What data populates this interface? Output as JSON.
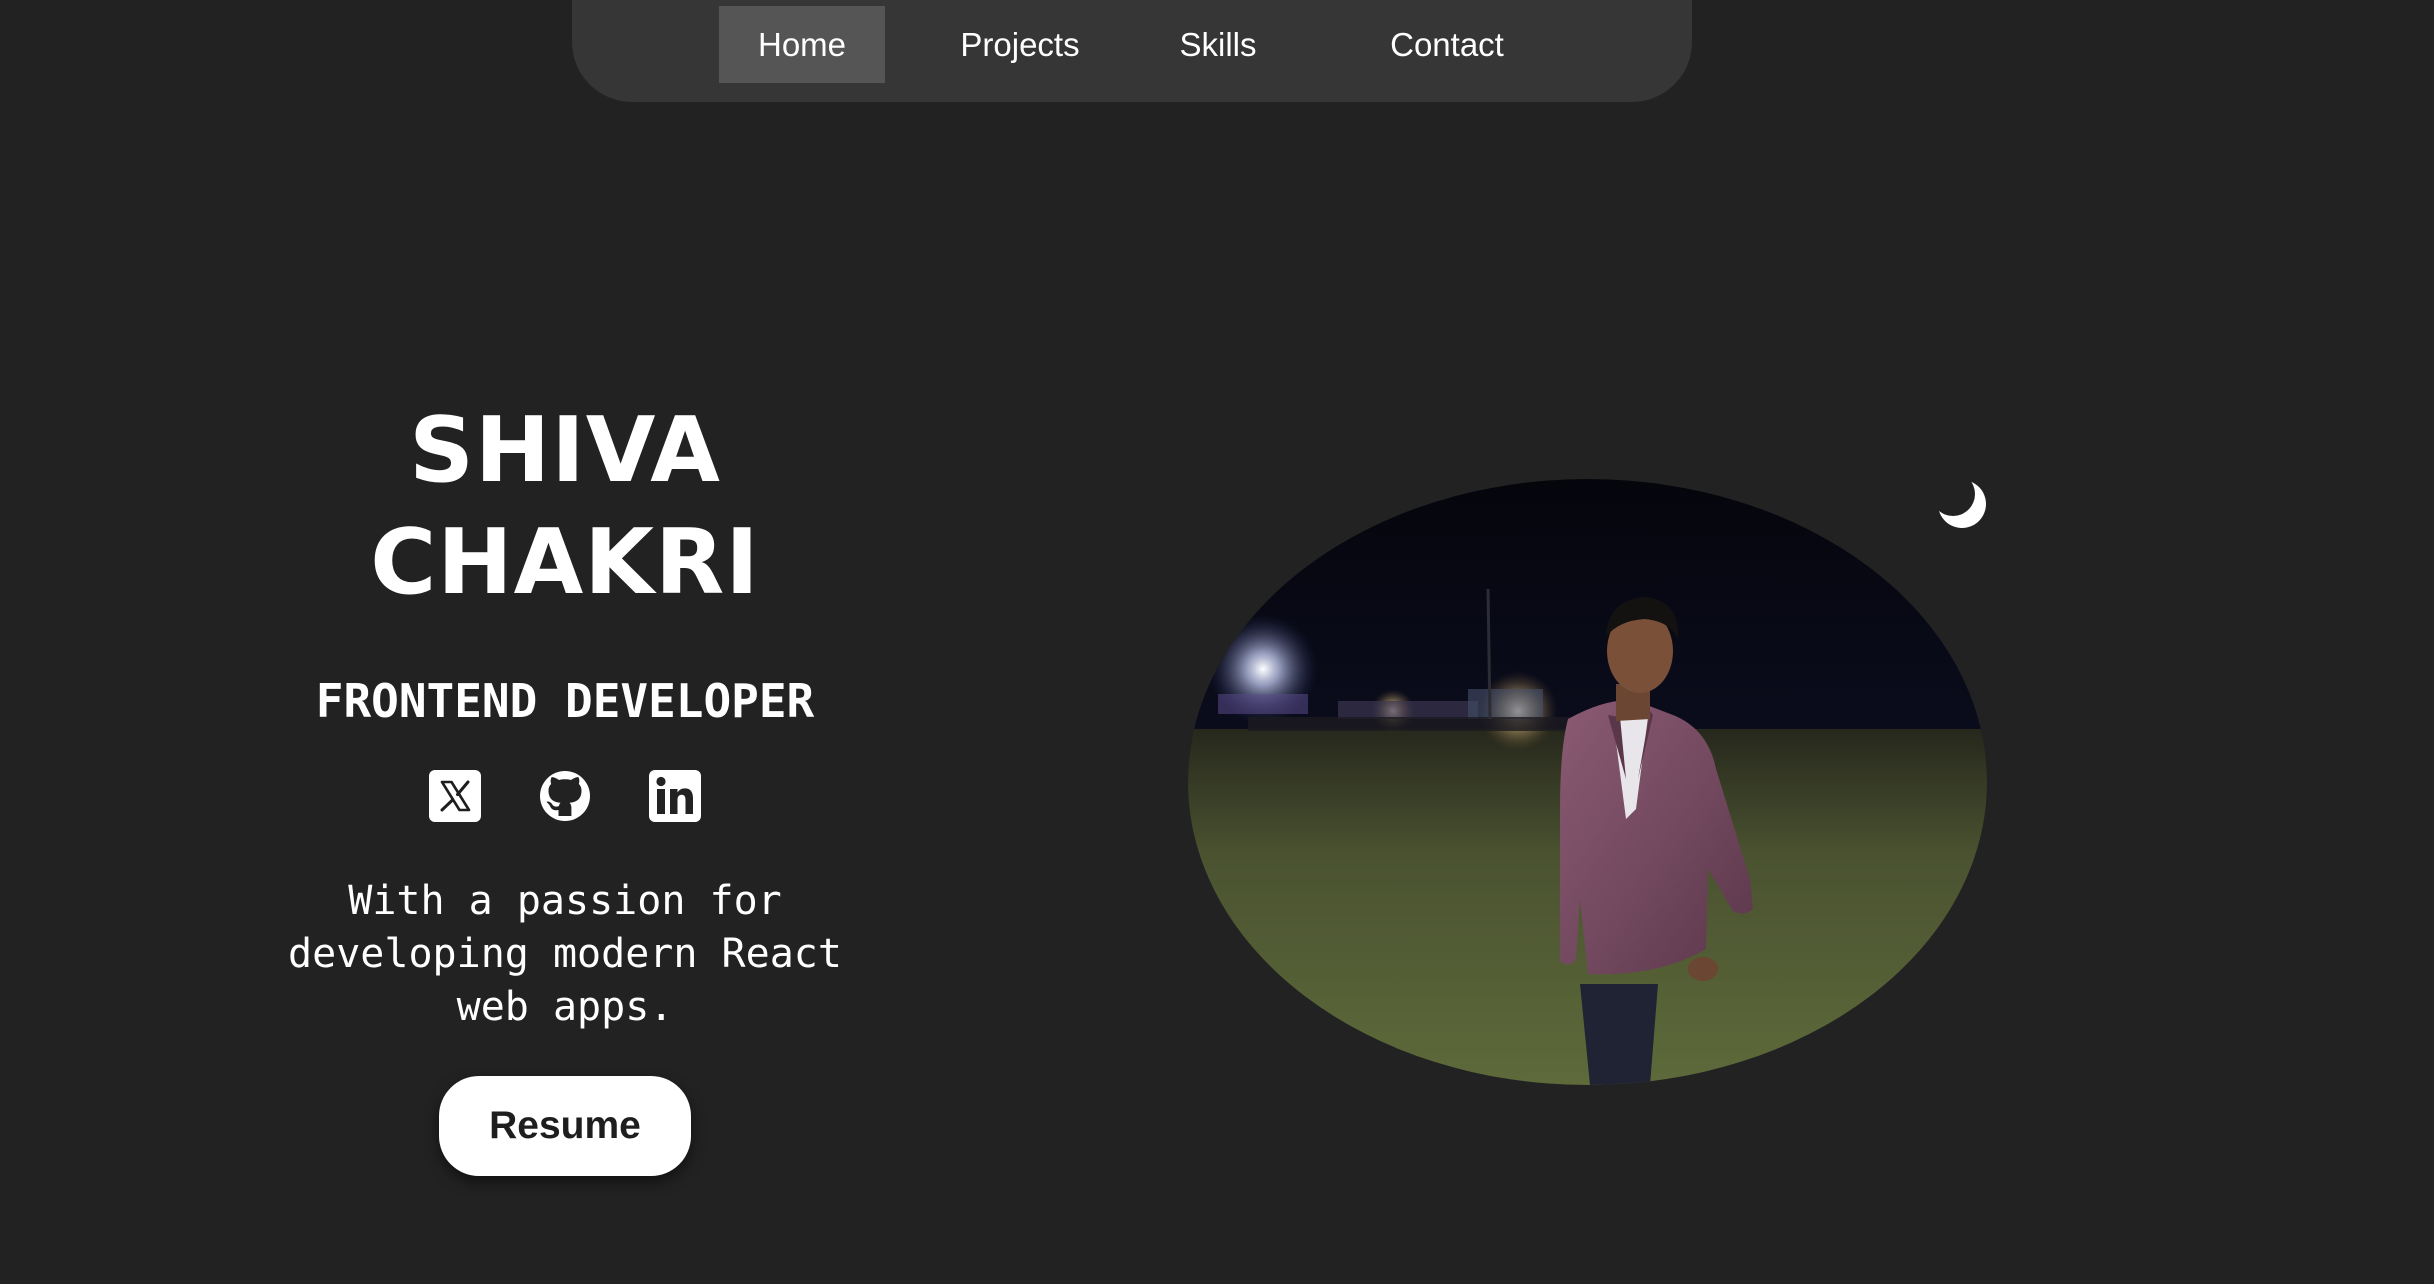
{
  "nav": {
    "items": [
      {
        "label": "Home",
        "active": true
      },
      {
        "label": "Projects",
        "active": false
      },
      {
        "label": "Skills",
        "active": false
      },
      {
        "label": "Contact",
        "active": false
      }
    ]
  },
  "hero": {
    "name_first": "SHIVA",
    "name_last": "CHAKRI",
    "role": "FRONTEND DEVELOPER",
    "tagline": "With a passion for developing modern React web apps.",
    "resume_label": "Resume",
    "socials": [
      {
        "icon": "x-twitter-icon"
      },
      {
        "icon": "github-icon"
      },
      {
        "icon": "linkedin-icon"
      }
    ],
    "photo_icon": "profile-photo",
    "theme_toggle_icon": "moon-icon"
  },
  "colors": {
    "background": "#222222",
    "nav_background": "#363636",
    "nav_active": "#555555",
    "text": "#ffffff",
    "button_background": "#ffffff",
    "button_text": "#1e1e1e"
  }
}
